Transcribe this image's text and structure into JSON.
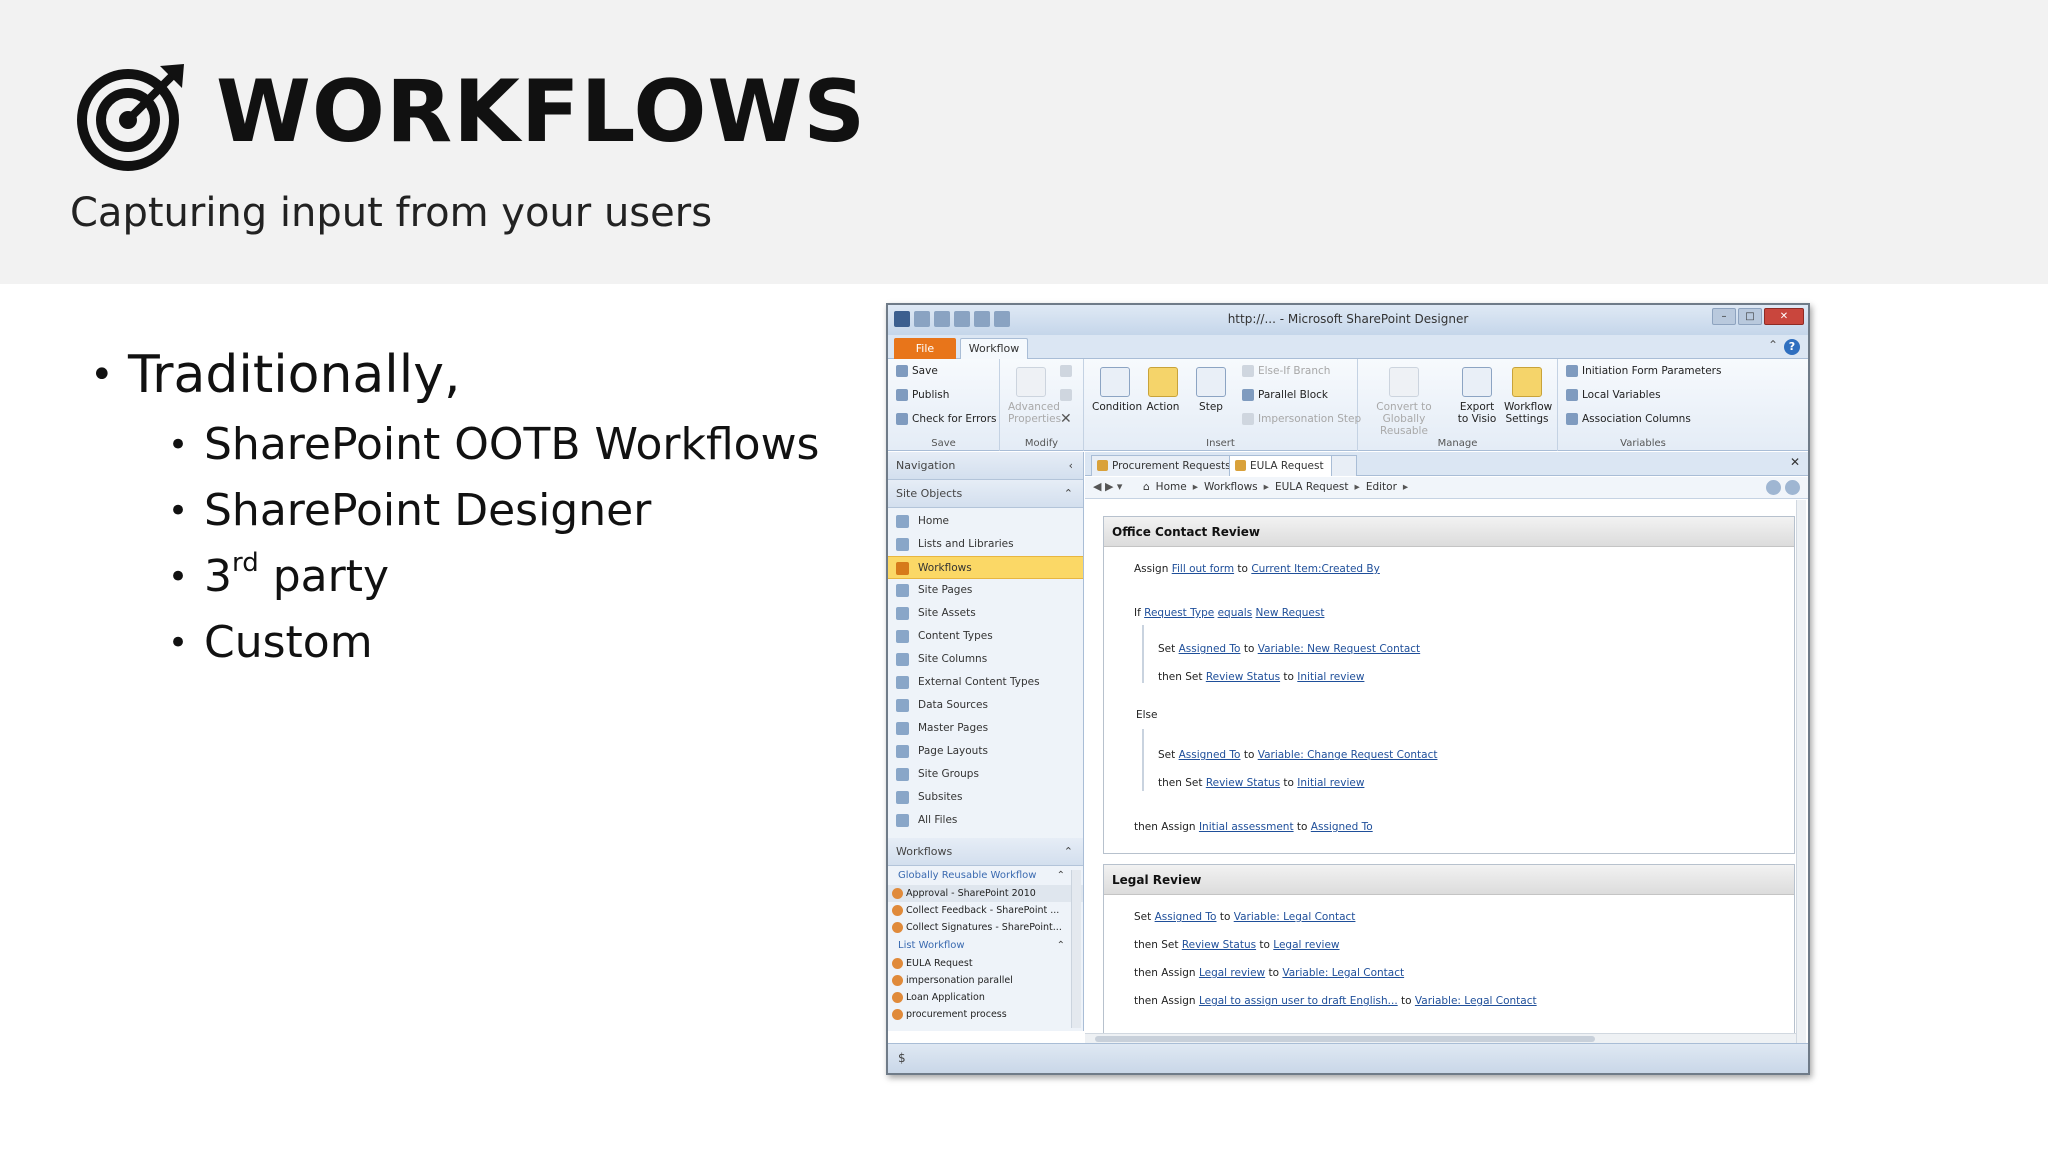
{
  "slide": {
    "title": "WORKFLOWS",
    "subtitle": "Capturing input from your users",
    "logo_icon": "target-arrow-icon"
  },
  "bullets": {
    "main": "Traditionally,",
    "items": [
      {
        "text": "SharePoint OOTB Workflows"
      },
      {
        "text": "SharePoint Designer"
      },
      {
        "text": "3",
        "sup": "rd",
        "rest": " party"
      },
      {
        "text": "Custom"
      }
    ]
  },
  "spd": {
    "window_title": "http://... - Microsoft SharePoint Designer",
    "tabs": {
      "file": "File",
      "workflow": "Workflow"
    },
    "ribbon": {
      "save_group": {
        "save": "Save",
        "publish": "Publish",
        "check": "Check for Errors",
        "label": "Save"
      },
      "modify_group": {
        "advanced": "Advanced Properties",
        "label": "Modify"
      },
      "insert_group": {
        "condition": "Condition",
        "action": "Action",
        "step": "Step",
        "else_if": "Else-If Branch",
        "parallel": "Parallel Block",
        "impersonation": "Impersonation Step",
        "label": "Insert"
      },
      "manage_group": {
        "convert": "Convert to Globally Reusable",
        "export": "Export to Visio",
        "settings": "Workflow Settings",
        "label": "Manage"
      },
      "variables_group": {
        "init": "Initiation Form Parameters",
        "local": "Local Variables",
        "assoc": "Association Columns",
        "label": "Variables"
      }
    },
    "nav": {
      "header": "Navigation",
      "site_objects": "Site Objects",
      "items": [
        "Home",
        "Lists and Libraries",
        "Workflows",
        "Site Pages",
        "Site Assets",
        "Content Types",
        "Site Columns",
        "External Content Types",
        "Data Sources",
        "Master Pages",
        "Page Layouts",
        "Site Groups",
        "Subsites",
        "All Files"
      ],
      "workflows_header": "Workflows",
      "global_group": "Globally Reusable Workflow",
      "global_items": [
        "Approval - SharePoint 2010",
        "Collect Feedback - SharePoint ...",
        "Collect Signatures - SharePoint..."
      ],
      "list_group": "List Workflow",
      "list_items": [
        "EULA Request",
        "impersonation parallel",
        "Loan Application",
        "procurement process"
      ]
    },
    "doc_tabs": [
      "Procurement Requests",
      "EULA Request"
    ],
    "breadcrumb": [
      "Home",
      "Workflows",
      "EULA Request",
      "Editor"
    ],
    "steps": {
      "step1": {
        "title": "Office Contact Review",
        "l1": {
          "a": "Assign ",
          "b": "Fill out form",
          "c": " to ",
          "d": "Current Item:Created By"
        },
        "l2": {
          "a": "If ",
          "b": "Request Type",
          "c": " ",
          "d": "equals",
          "e": " ",
          "f": "New Request"
        },
        "l3": {
          "a": "Set ",
          "b": "Assigned To",
          "c": " to ",
          "d": "Variable: New Request Contact"
        },
        "l4": {
          "a": "then Set ",
          "b": "Review Status",
          "c": " to ",
          "d": "Initial review"
        },
        "l5": "Else",
        "l6": {
          "a": "Set ",
          "b": "Assigned To",
          "c": " to ",
          "d": "Variable: Change Request Contact"
        },
        "l7": {
          "a": "then Set ",
          "b": "Review Status",
          "c": " to ",
          "d": "Initial review"
        },
        "l8": {
          "a": "then Assign ",
          "b": "Initial assessment",
          "c": " to ",
          "d": "Assigned To"
        }
      },
      "step2": {
        "title": "Legal Review",
        "l1": {
          "a": "Set ",
          "b": "Assigned To",
          "c": " to ",
          "d": "Variable: Legal Contact"
        },
        "l2": {
          "a": "then Set ",
          "b": "Review Status",
          "c": " to ",
          "d": "Legal review"
        },
        "l3": {
          "a": "then Assign ",
          "b": "Legal review",
          "c": " to ",
          "d": "Variable: Legal Contact"
        },
        "l4": {
          "a": "then Assign ",
          "b": "Legal to assign user to draft English...",
          "c": " to ",
          "d": "Variable: Legal Contact"
        }
      }
    }
  }
}
